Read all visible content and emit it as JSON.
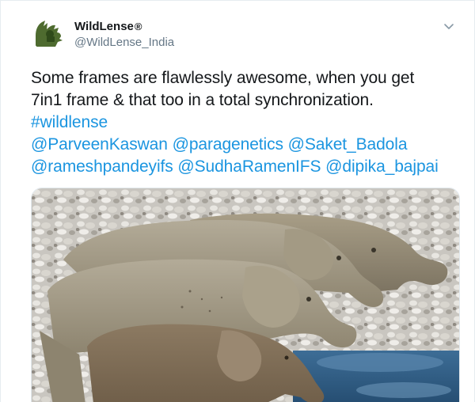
{
  "tweet": {
    "display_name": "WildLense",
    "registered_mark": "®",
    "handle": "@WildLense_India",
    "text_line1": "Some frames are flawlessly awesome, when you get",
    "text_line2": "7in1 frame & that too in a total synchronization.",
    "hashtag": "#wildlense",
    "mentions_line1": [
      "@ParveenKaswan",
      "@paragenetics",
      "@Saket_Badola"
    ],
    "mentions_line2": [
      "@rameshpandeyifs",
      "@SudhaRamenIFS",
      "@dipika_bajpai"
    ],
    "avatar_icon": "wildlense-logo-icon",
    "caret_icon": "chevron-down-icon",
    "media_icon": "elephants-drinking-photo"
  },
  "colors": {
    "link": "#1b95e0",
    "text": "#14171a",
    "secondary": "#657786",
    "logo": "#4e6b2f"
  }
}
